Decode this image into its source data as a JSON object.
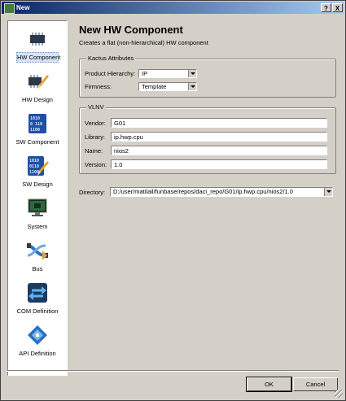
{
  "window": {
    "title": "New",
    "help_label": "?",
    "close_label": "X"
  },
  "sidebar": {
    "items": [
      {
        "label": "HW Component",
        "icon": "chip-icon"
      },
      {
        "label": "HW Design",
        "icon": "chip-pencil-icon"
      },
      {
        "label": "SW Component",
        "icon": "binary-icon"
      },
      {
        "label": "SW Design",
        "icon": "binary-pencil-icon"
      },
      {
        "label": "System",
        "icon": "monitor-chip-icon"
      },
      {
        "label": "Bus",
        "icon": "bus-icon"
      },
      {
        "label": "COM Definition",
        "icon": "com-arrows-icon"
      },
      {
        "label": "API Definition",
        "icon": "api-icon"
      }
    ],
    "selected": "HW Component"
  },
  "header": {
    "title": "New HW Component",
    "description": "Creates a flat (non-hierarchical) HW component"
  },
  "kactus": {
    "title": "Kactus Attributes",
    "hierarchy_label": "Product Hierarchy:",
    "hierarchy_value": "IP",
    "firmness_label": "Firmness:",
    "firmness_value": "Template"
  },
  "vlnv": {
    "title": "VLNV",
    "vendor_label": "Vendor:",
    "vendor_value": "G01",
    "library_label": "Library:",
    "library_value": "ip.hwp.cpu",
    "name_label": "Name:",
    "name_value": "nios2",
    "version_label": "Version:",
    "version_value": "1.0"
  },
  "directory": {
    "label": "Directory:",
    "value": "D:/user/matilail/funbase/repos/daci_repo/G01/ip.hwp.cpu/nios2/1.0"
  },
  "buttons": {
    "ok": "OK",
    "cancel": "Cancel"
  }
}
